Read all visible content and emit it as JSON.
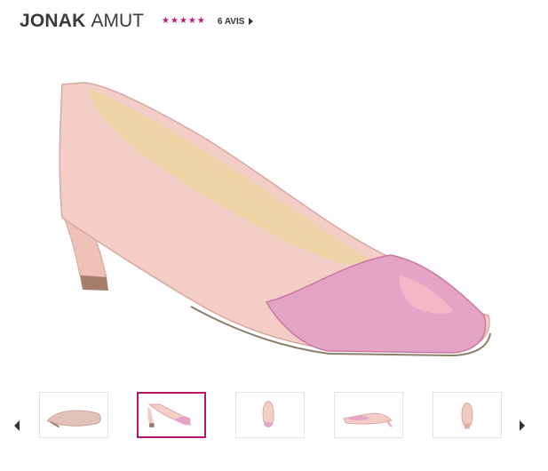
{
  "product": {
    "brand": "JONAK",
    "model": "AMUT",
    "rating_stars": [
      "★",
      "★",
      "★",
      "★",
      "★"
    ],
    "rating_value": 5,
    "reviews_label": "6 AVIS"
  },
  "colors": {
    "accent": "#c2157f",
    "thumb_active_border": "#b5176f",
    "shoe_body": "#f3cdc6",
    "shoe_toe": "#e3a4c6",
    "insole": "#eed3a7"
  },
  "gallery": {
    "main_image_alt": "",
    "thumbnails_count": 5,
    "active_index": 1
  }
}
